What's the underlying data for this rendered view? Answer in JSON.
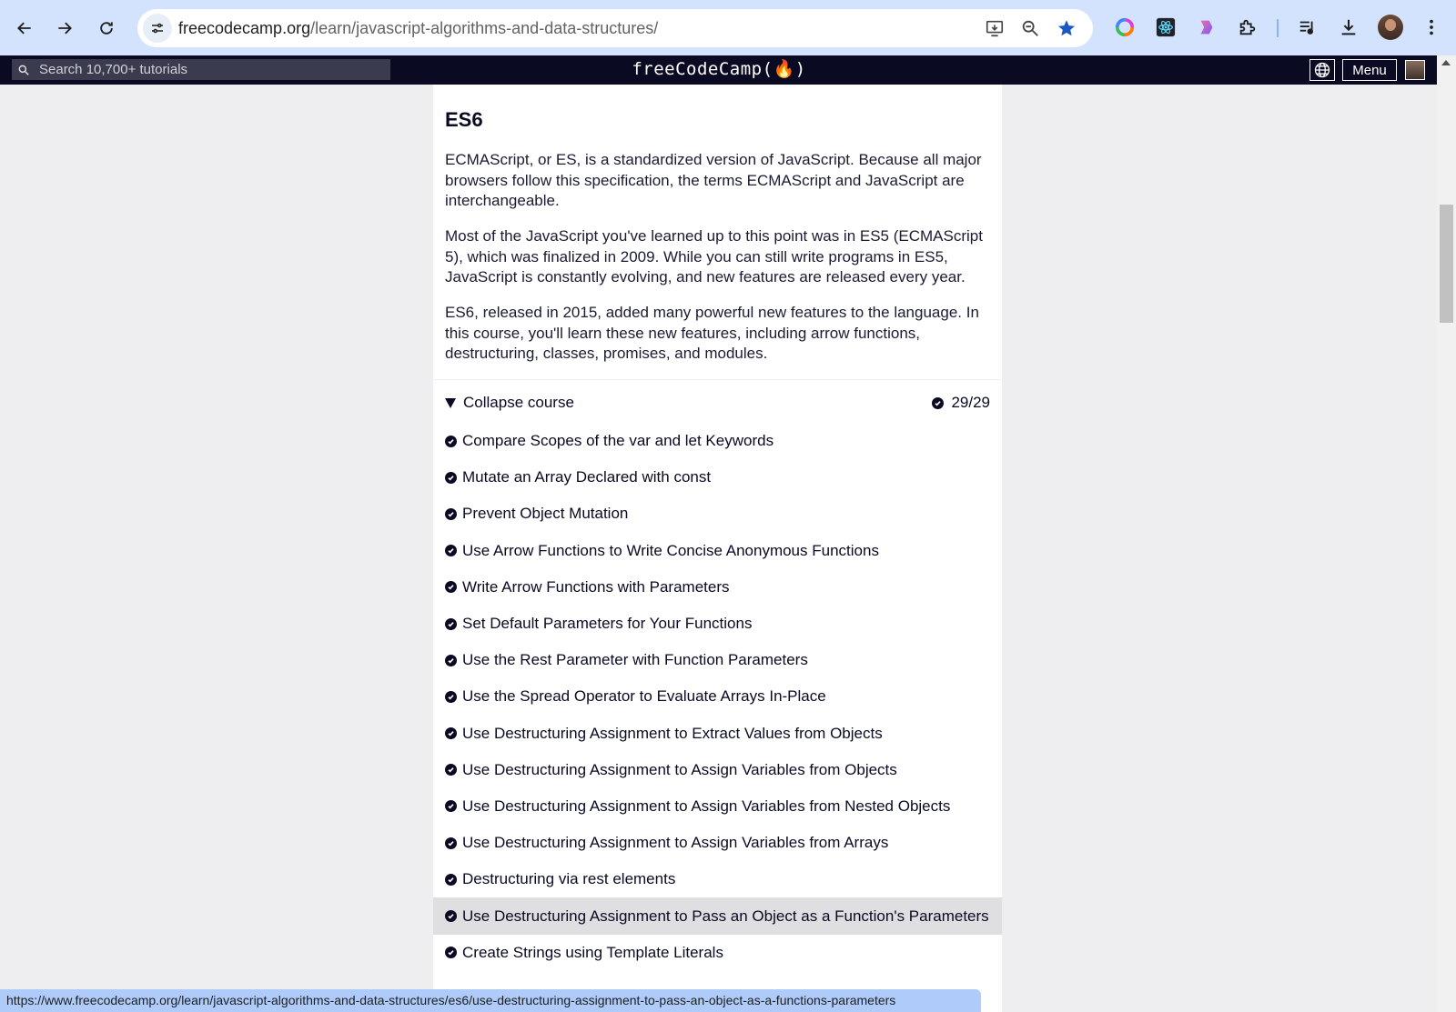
{
  "browser": {
    "url_host": "freecodecamp.org",
    "url_path": "/learn/javascript-algorithms-and-data-structures/",
    "status_url": "https://www.freecodecamp.org/learn/javascript-algorithms-and-data-structures/es6/use-destructuring-assignment-to-pass-an-object-as-a-functions-parameters",
    "icons": [
      "back-icon",
      "forward-icon",
      "reload-icon",
      "site-info-icon",
      "install-app-icon",
      "zoom-icon",
      "bookmark-star-icon",
      "color-extension-icon",
      "react-devtools-icon",
      "gradient-extension-icon",
      "extensions-puzzle-icon",
      "media-queue-icon",
      "download-icon",
      "profile-avatar",
      "more-menu-icon"
    ],
    "accent_color": "#d3e3fd",
    "star_color": "#1a56c4"
  },
  "fcc": {
    "search_placeholder": "Search 10,700+ tutorials",
    "logo": "freeCodeCamp(🔥)",
    "menu_label": "Menu",
    "nav_bg": "#0a0a23"
  },
  "course": {
    "title": "ES6",
    "paragraphs": [
      "ECMAScript, or ES, is a standardized version of JavaScript. Because all major browsers follow this specification, the terms ECMAScript and JavaScript are interchangeable.",
      "Most of the JavaScript you've learned up to this point was in ES5 (ECMAScript 5), which was finalized in 2009. While you can still write programs in ES5, JavaScript is constantly evolving, and new features are released every year.",
      "ES6, released in 2015, added many powerful new features to the language. In this course, you'll learn these new features, including arrow functions, destructuring, classes, promises, and modules."
    ],
    "collapse_label": "Collapse course",
    "progress": "29/29",
    "lessons": [
      "Compare Scopes of the var and let Keywords",
      "Mutate an Array Declared with const",
      "Prevent Object Mutation",
      "Use Arrow Functions to Write Concise Anonymous Functions",
      "Write Arrow Functions with Parameters",
      "Set Default Parameters for Your Functions",
      "Use the Rest Parameter with Function Parameters",
      "Use the Spread Operator to Evaluate Arrays In-Place",
      "Use Destructuring Assignment to Extract Values from Objects",
      "Use Destructuring Assignment to Assign Variables from Objects",
      "Use Destructuring Assignment to Assign Variables from Nested Objects",
      "Use Destructuring Assignment to Assign Variables from Arrays",
      "Destructuring via rest elements",
      "Use Destructuring Assignment to Pass an Object as a Function's Parameters",
      "Create Strings using Template Literals"
    ],
    "hovered_lesson_index": 13
  }
}
